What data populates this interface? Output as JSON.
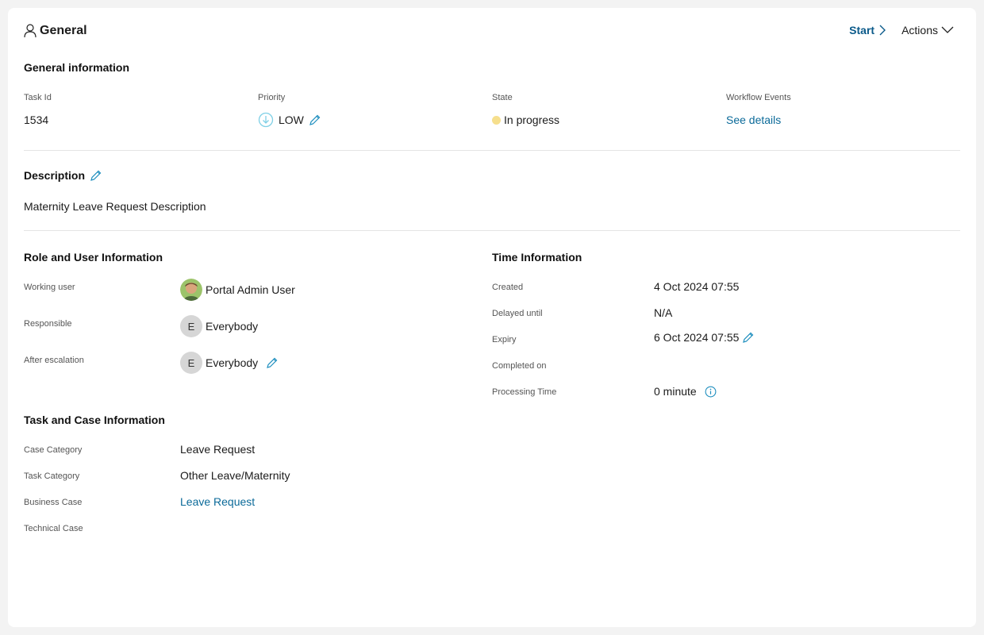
{
  "header": {
    "title": "General",
    "title_icon": "person-icon",
    "start_label": "Start",
    "actions_label": "Actions"
  },
  "general_info": {
    "title": "General information",
    "task_id_label": "Task Id",
    "task_id": "1534",
    "priority_label": "Priority",
    "priority": "LOW",
    "state_label": "State",
    "state": "In progress",
    "state_color": "#f6df8d",
    "workflow_label": "Workflow Events",
    "workflow_link": "See details"
  },
  "description": {
    "title": "Description",
    "text": "Maternity Leave Request Description"
  },
  "role_user": {
    "title": "Role and User Information",
    "working_user_label": "Working user",
    "working_user": "Portal Admin User",
    "responsible_label": "Responsible",
    "responsible_initial": "E",
    "responsible": "Everybody",
    "escalation_label": "After escalation",
    "escalation_initial": "E",
    "escalation": "Everybody"
  },
  "time_info": {
    "title": "Time Information",
    "created_label": "Created",
    "created": "4 Oct 2024 07:55",
    "delayed_label": "Delayed until",
    "delayed": "N/A",
    "expiry_label": "Expiry",
    "expiry": "6 Oct 2024 07:55",
    "completed_label": "Completed on",
    "completed": "",
    "processing_label": "Processing Time",
    "processing": "0 minute"
  },
  "task_case": {
    "title": "Task and Case Information",
    "case_category_label": "Case Category",
    "case_category": "Leave Request",
    "task_category_label": "Task Category",
    "task_category": "Other Leave/Maternity",
    "business_case_label": "Business Case",
    "business_case": "Leave Request",
    "technical_case_label": "Technical Case",
    "technical_case": ""
  },
  "colors": {
    "link": "#0b6a99",
    "accent_icon": "#2a9fc9"
  }
}
